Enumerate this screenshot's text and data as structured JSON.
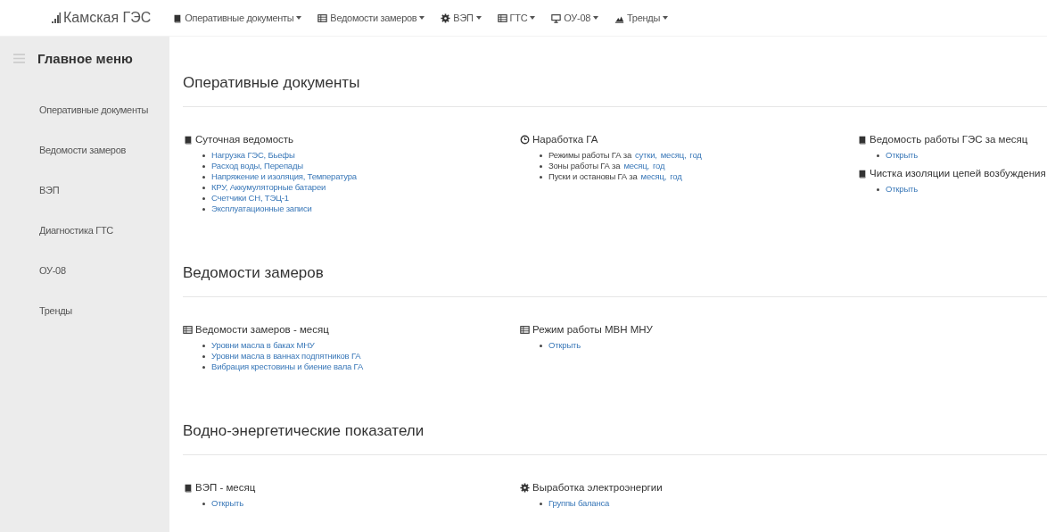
{
  "navbar": {
    "brand": "Камская ГЭС",
    "items": [
      {
        "kind": "book",
        "label": "Оперативные документы"
      },
      {
        "kind": "table",
        "label": "Ведомости замеров"
      },
      {
        "kind": "gear",
        "label": "ВЭП"
      },
      {
        "kind": "table",
        "label": "ГТС"
      },
      {
        "kind": "monitor",
        "label": "ОУ-08"
      },
      {
        "kind": "chart",
        "label": "Тренды"
      }
    ]
  },
  "sidebar": {
    "title": "Главное меню",
    "items": [
      "Оперативные документы",
      "Ведомости замеров",
      "ВЭП",
      "Диагностика ГТС",
      "ОУ-08",
      "Тренды"
    ]
  },
  "sections": [
    {
      "title": "Оперативные документы",
      "columns": [
        [
          {
            "kind": "book",
            "title": "Суточная ведомость",
            "items": [
              {
                "links": [
                  "Нагрузка ГЭС, Бьефы"
                ]
              },
              {
                "links": [
                  "Расход воды, Перепады"
                ]
              },
              {
                "links": [
                  "Напряжение и изоляция, Температура"
                ]
              },
              {
                "links": [
                  "КРУ, Аккумуляторные батареи"
                ]
              },
              {
                "links": [
                  "Счетчики СН, ТЭЦ-1"
                ]
              },
              {
                "links": [
                  "Эксплуатационные записи"
                ]
              }
            ]
          }
        ],
        [
          {
            "kind": "clock",
            "title": "Наработка ГА",
            "items": [
              {
                "text": "Режимы работы ГА за",
                "links": [
                  "сутки,",
                  "месяц,",
                  "год"
                ]
              },
              {
                "text": "Зоны работы ГА за",
                "links": [
                  "месяц,",
                  "год"
                ]
              },
              {
                "text": "Пуски и остановы ГА за",
                "links": [
                  "месяц,",
                  "год"
                ]
              }
            ]
          }
        ],
        [
          {
            "kind": "book",
            "title": "Ведомость работы ГЭС за месяц",
            "items": [
              {
                "links": [
                  "Открыть"
                ]
              }
            ]
          },
          {
            "kind": "book",
            "title": "Чистка изоляции цепей возбуждения",
            "items": [
              {
                "links": [
                  "Открыть"
                ]
              }
            ]
          }
        ]
      ]
    },
    {
      "title": "Ведомости замеров",
      "columns": [
        [
          {
            "kind": "table",
            "title": "Ведомости замеров - месяц",
            "items": [
              {
                "links": [
                  "Уровни масла в баках МНУ"
                ]
              },
              {
                "links": [
                  "Уровни масла в ваннах подпятников ГА"
                ]
              },
              {
                "links": [
                  "Вибрация крестовины и биение вала ГА"
                ]
              }
            ]
          }
        ],
        [
          {
            "kind": "table",
            "title": "Режим работы МВН МНУ",
            "items": [
              {
                "links": [
                  "Открыть"
                ]
              }
            ]
          }
        ],
        []
      ]
    },
    {
      "title": "Водно-энергетические показатели",
      "columns": [
        [
          {
            "kind": "book",
            "title": "ВЭП - месяц",
            "items": [
              {
                "links": [
                  "Открыть"
                ]
              }
            ]
          }
        ],
        [
          {
            "kind": "gear",
            "title": "Выработка электроэнергии",
            "items": [
              {
                "links": [
                  "Группы баланса"
                ]
              }
            ]
          }
        ],
        []
      ]
    }
  ]
}
